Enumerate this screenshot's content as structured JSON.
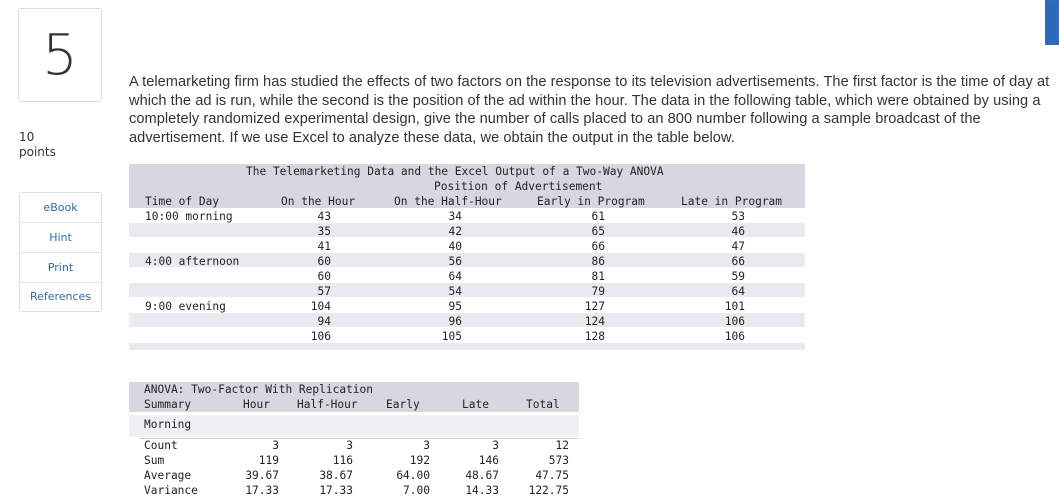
{
  "question": {
    "number": "5",
    "points_value": "10",
    "points_label": "points",
    "text": "A telemarketing firm has studied the effects of two factors on the response to its television advertisements. The first factor is the time of day at which the ad is run, while the second is the position of the ad within the hour. The data in the following table, which were obtained by using a completely randomized experimental design, give the number of calls placed to an 800 number following a sample broadcast of the advertisement. If we use Excel to analyze these data, we obtain the output in the table below."
  },
  "sidebar": {
    "links": [
      "eBook",
      "Hint",
      "Print",
      "References"
    ]
  },
  "data_table": {
    "title": "The Telemarketing Data and the Excel Output of a Two-Way ANOVA",
    "group_header": "Position of Advertisement",
    "row_header": "Time of Day",
    "columns": [
      "On the Hour",
      "On the Half-Hour",
      "Early in Program",
      "Late in Program"
    ],
    "groups": [
      {
        "label": "10:00 morning",
        "rows": [
          [
            "43",
            "34",
            "61",
            "53"
          ],
          [
            "35",
            "42",
            "65",
            "46"
          ],
          [
            "41",
            "40",
            "66",
            "47"
          ]
        ]
      },
      {
        "label": "4:00 afternoon",
        "rows": [
          [
            "60",
            "56",
            "86",
            "66"
          ],
          [
            "60",
            "64",
            "81",
            "59"
          ],
          [
            "57",
            "54",
            "79",
            "64"
          ]
        ]
      },
      {
        "label": "9:00 evening",
        "rows": [
          [
            "104",
            "95",
            "127",
            "101"
          ],
          [
            "94",
            "96",
            "124",
            "106"
          ],
          [
            "106",
            "105",
            "128",
            "106"
          ]
        ]
      }
    ]
  },
  "anova": {
    "title": "ANOVA: Two-Factor With Replication",
    "headers": [
      "Summary",
      "Hour",
      "Half-Hour",
      "Early",
      "Late",
      "Total"
    ],
    "section": "Morning",
    "rows": [
      [
        "Count",
        "3",
        "3",
        "3",
        "3",
        "12"
      ],
      [
        "Sum",
        "119",
        "116",
        "192",
        "146",
        "573"
      ],
      [
        "Average",
        "39.67",
        "38.67",
        "64.00",
        "48.67",
        "47.75"
      ],
      [
        "Variance",
        "17.33",
        "17.33",
        "7.00",
        "14.33",
        "122.75"
      ]
    ]
  }
}
